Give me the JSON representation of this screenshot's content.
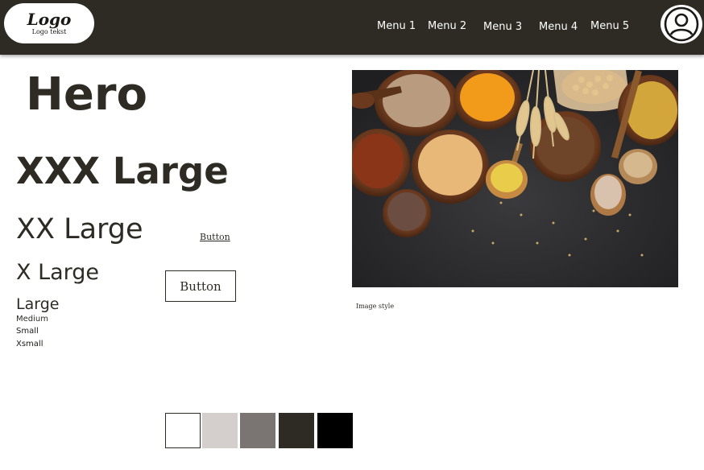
{
  "header": {
    "logo": {
      "title": "Logo",
      "subtitle": "Logo tekst"
    },
    "nav": [
      {
        "label": "Menu 1"
      },
      {
        "label": "Menu 2"
      },
      {
        "label": "Menu 3"
      },
      {
        "label": "Menu 4"
      },
      {
        "label": "Menu 5"
      }
    ],
    "avatar_icon": "user-circle-icon"
  },
  "typography": {
    "hero": "Hero",
    "xxx_large": "XXX Large",
    "xx_large": "XX Large",
    "x_large": "X Large",
    "large": "Large",
    "medium": "Medium",
    "small": "Small",
    "xsmall": "Xsmall"
  },
  "buttons": {
    "link_button": "Button",
    "outline_button": "Button"
  },
  "image": {
    "caption": "Image style",
    "subject": "bowls of grains, seeds and legumes with wheat ears on dark background"
  },
  "colors": {
    "primary": "#2e2b25",
    "palette": [
      "#ffffff",
      "#d4cfcc",
      "#7a7472",
      "#2e2b25",
      "#000000"
    ]
  }
}
